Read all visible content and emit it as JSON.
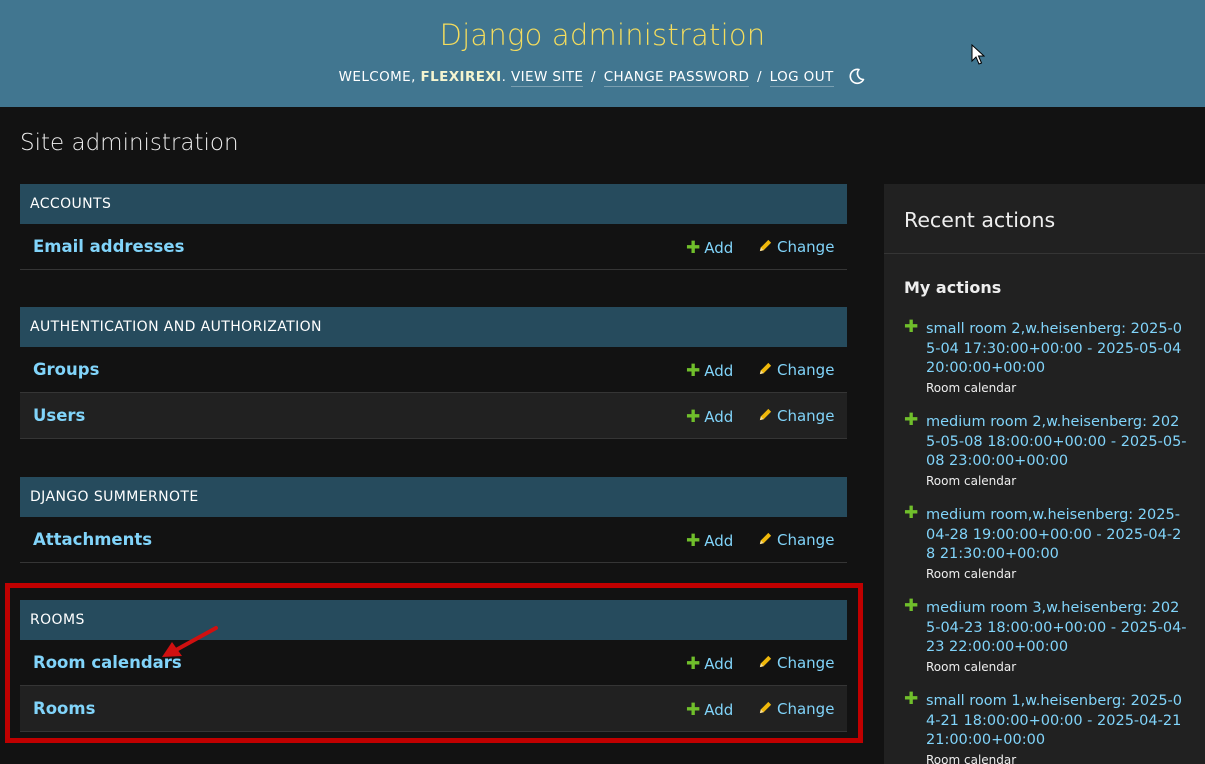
{
  "header": {
    "site_name": "Django administration",
    "welcome": "WELCOME,",
    "username": "FLEXIREXI",
    "view_site": "VIEW SITE",
    "change_password": "CHANGE PASSWORD",
    "log_out": "LOG OUT",
    "sep": "/",
    "theme_icon": "moon-icon"
  },
  "page_title": "Site administration",
  "modules": [
    {
      "caption": "ACCOUNTS",
      "models": [
        {
          "name": "Email addresses",
          "add": "Add",
          "change": "Change"
        }
      ]
    },
    {
      "caption": "AUTHENTICATION AND AUTHORIZATION",
      "models": [
        {
          "name": "Groups",
          "add": "Add",
          "change": "Change"
        },
        {
          "name": "Users",
          "add": "Add",
          "change": "Change"
        }
      ]
    },
    {
      "caption": "DJANGO SUMMERNOTE",
      "models": [
        {
          "name": "Attachments",
          "add": "Add",
          "change": "Change"
        }
      ]
    },
    {
      "caption": "ROOMS",
      "models": [
        {
          "name": "Room calendars",
          "add": "Add",
          "change": "Change"
        },
        {
          "name": "Rooms",
          "add": "Add",
          "change": "Change"
        }
      ]
    }
  ],
  "recent_actions": {
    "title": "Recent actions",
    "my_actions": "My actions",
    "items": [
      {
        "text": "small room 2,w.heisenberg: 2025-05-04 17:30:00+00:00 - 2025-05-04 20:00:00+00:00",
        "type": "Room calendar"
      },
      {
        "text": "medium room 2,w.heisenberg: 2025-05-08 18:00:00+00:00 - 2025-05-08 23:00:00+00:00",
        "type": "Room calendar"
      },
      {
        "text": "medium room,w.heisenberg: 2025-04-28 19:00:00+00:00 - 2025-04-28 21:30:00+00:00",
        "type": "Room calendar"
      },
      {
        "text": "medium room 3,w.heisenberg: 2025-04-23 18:00:00+00:00 - 2025-04-23 22:00:00+00:00",
        "type": "Room calendar"
      },
      {
        "text": "small room 1,w.heisenberg: 2025-04-21 18:00:00+00:00 - 2025-04-21 21:00:00+00:00",
        "type": "Room calendar"
      }
    ]
  },
  "icons": {
    "add": "plus-icon",
    "change": "pencil-icon"
  },
  "colors": {
    "header_bg": "#417690",
    "site_name": "#f5dd5d",
    "caption_bg": "#264b5d",
    "link": "#81d4fa",
    "add_green": "#70bf2b",
    "pencil_yellow": "#efb80b",
    "highlight_red": "#c00000"
  }
}
